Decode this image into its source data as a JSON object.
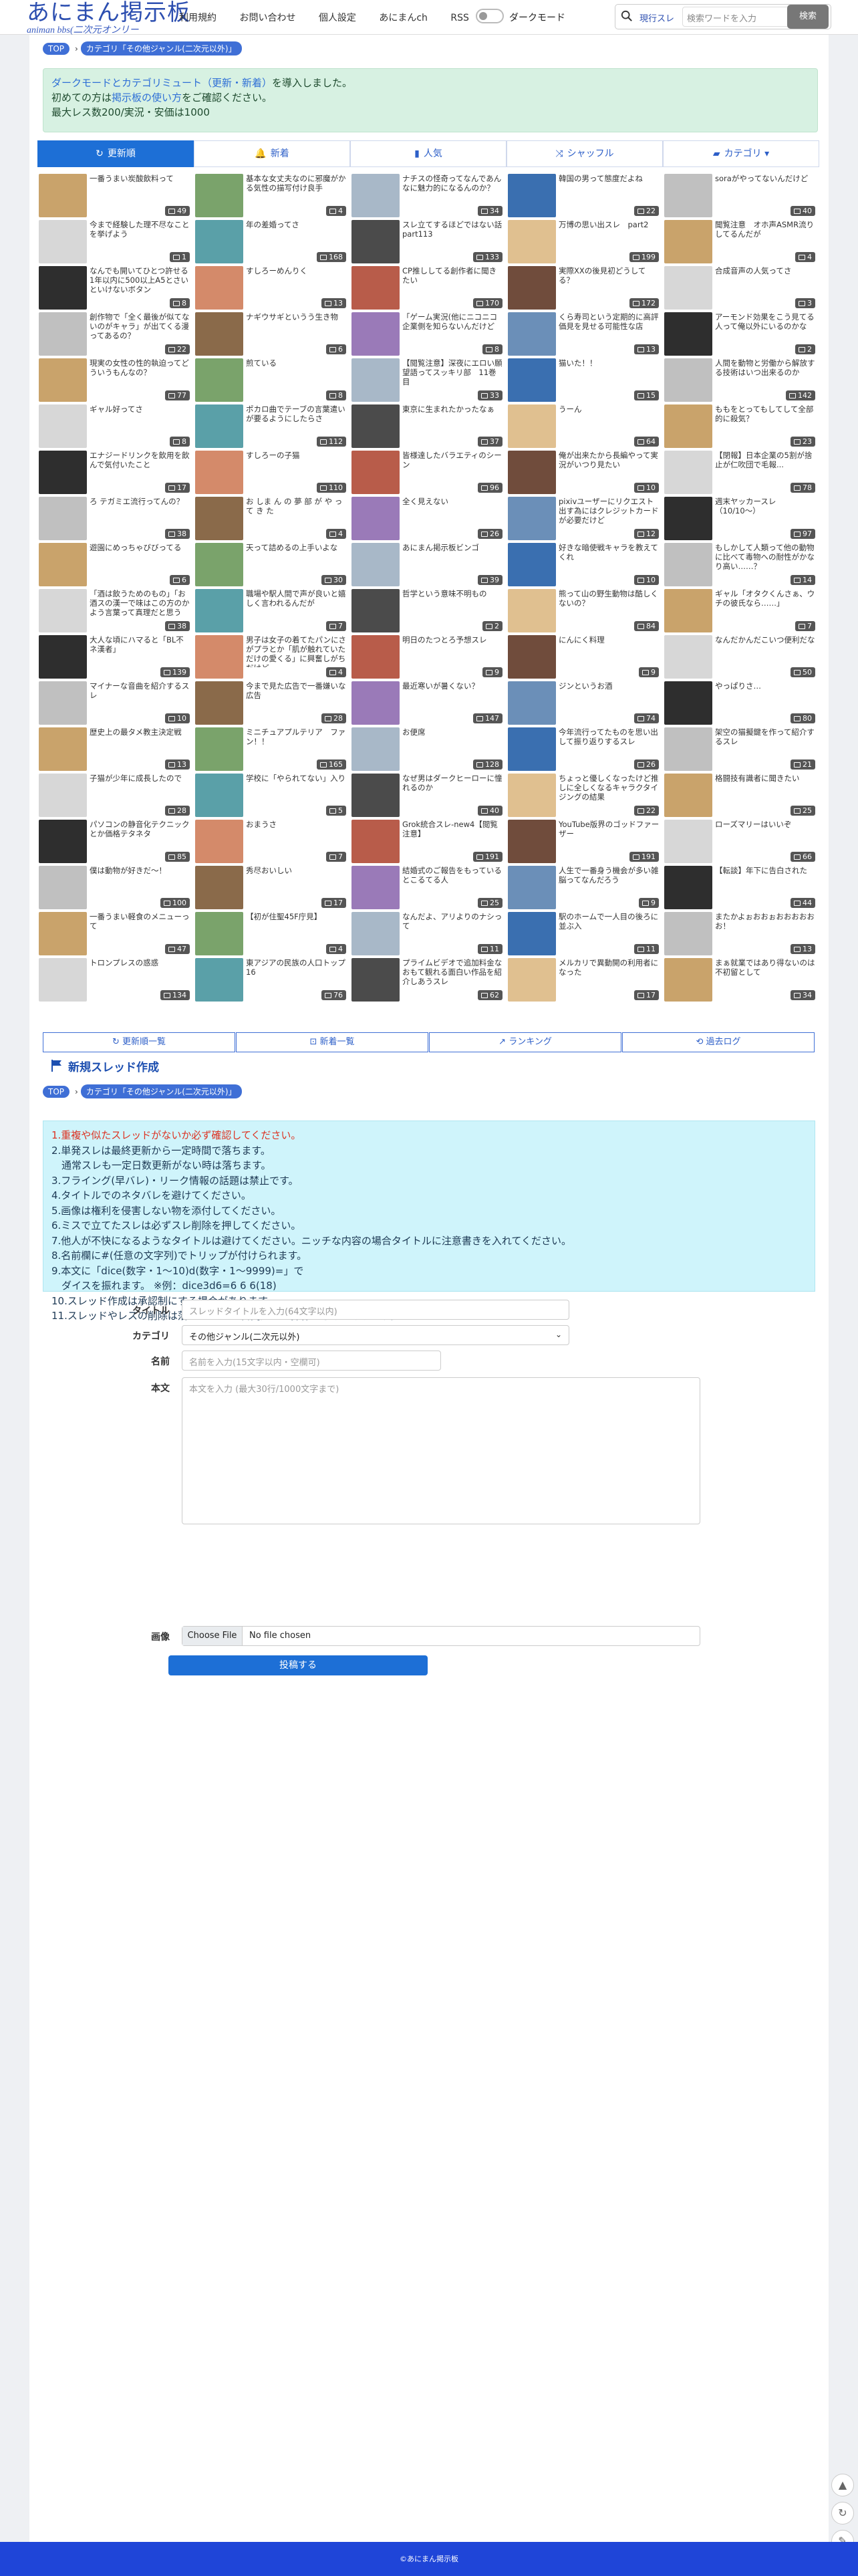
{
  "header": {
    "logo_title": "あにまん掲示板",
    "logo_sub": "animan bbs(二次元オンリー",
    "nav": [
      "利用規約",
      "お問い合わせ",
      "個人設定",
      "あにまんch",
      "RSS"
    ],
    "darkmode_label": "ダークモード",
    "search_scope": "現行スレ",
    "search_placeholder": "検索ワードを入力",
    "search_button": "検索"
  },
  "breadcrumb": {
    "top": "TOP",
    "category": "カテゴリ「その他ジャンル(二次元以外)」"
  },
  "notice": {
    "line1a": "ダークモードとカテゴリミュート（更新・新着）",
    "line1b": "を導入しました。",
    "line2a": "初めての方は",
    "line2b": "掲示板の使い方",
    "line2c": "をご確認ください。",
    "line3": "最大レス数200/実況・安価は1000"
  },
  "tabs": [
    {
      "label": "更新順",
      "icon": "refresh-icon"
    },
    {
      "label": "新着",
      "icon": "bell-icon"
    },
    {
      "label": "人気",
      "icon": "bar-chart-icon"
    },
    {
      "label": "シャッフル",
      "icon": "shuffle-icon"
    },
    {
      "label": "カテゴリ",
      "icon": "folder-icon"
    }
  ],
  "threads": [
    {
      "title": "一番うまい炭酸飲料って",
      "count": "49"
    },
    {
      "title": "基本な女丈夫なのに邪魔がかる気性の描写付け良手",
      "count": "4"
    },
    {
      "title": "ナチスの怪奇ってなんであんなに魅力的になるんのか？",
      "count": "34"
    },
    {
      "title": "韓国の男って態度だよね",
      "count": "22"
    },
    {
      "title": "soraがやってないんだけど",
      "count": "40"
    },
    {
      "title": "今まで経験した理不尽なことを挙げよう",
      "count": "1"
    },
    {
      "title": "年の差婚ってさ",
      "count": "168"
    },
    {
      "title": "スレ立てするほどではない話part113",
      "count": "133"
    },
    {
      "title": "万博の思い出スレ　part2",
      "count": "199"
    },
    {
      "title": "聞覧注意　オホ声ASMR流りしてるんだが",
      "count": "4"
    },
    {
      "title": "なんでも開いてひとつ許せる1年以内に500以上A5とさいといけないボタン",
      "count": "8"
    },
    {
      "title": "すしろーめんりく",
      "count": "13"
    },
    {
      "title": "CP推ししてる創作者に聞きたい",
      "count": "170"
    },
    {
      "title": "実際XXの後見初どうしてる？",
      "count": "172"
    },
    {
      "title": "合成音声の人気ってさ",
      "count": "3"
    },
    {
      "title": "創作物で「全く最後が似てないのがキャラ」が出てくる漫ってあるの？",
      "count": "22"
    },
    {
      "title": "ナギウサギというう生き物",
      "count": "6"
    },
    {
      "title": "「ゲーム実況(他にニコニコ企業側を知らないんだけど",
      "count": "8"
    },
    {
      "title": "くら寿司という定期的に高評価見を見せる可能性な店",
      "count": "13"
    },
    {
      "title": "アーモンド効果をこう見てる人って俺以外にいるのかな",
      "count": "2"
    },
    {
      "title": "現実の女性の性的執迫ってどういうもんなの？",
      "count": "77"
    },
    {
      "title": "煎ている",
      "count": "8"
    },
    {
      "title": "【閲覧注意】深夜にエロい願望語ってスッキリ部　11巻目",
      "count": "33"
    },
    {
      "title": "猫いた！！",
      "count": "15"
    },
    {
      "title": "人間を動物と労働から解放する技術はいつ出来るのか",
      "count": "142"
    },
    {
      "title": "ギャル好ってさ",
      "count": "8"
    },
    {
      "title": "ポカロ曲でテーブの言葉遣いが要るようにしたらさ",
      "count": "112"
    },
    {
      "title": "東京に生まれたかったなぁ",
      "count": "37"
    },
    {
      "title": "うーん",
      "count": "64"
    },
    {
      "title": "ももをとってもしてして全部的に殺気？",
      "count": "23"
    },
    {
      "title": "エナジードリンクを飲用を飲んで気付いたこと",
      "count": "17"
    },
    {
      "title": "すしろーの子猫",
      "count": "110"
    },
    {
      "title": "皆様達したバラエティのシーン",
      "count": "96"
    },
    {
      "title": "俺が出来たから長編やって実況がいつり見たい",
      "count": "10"
    },
    {
      "title": "【閉報】日本企業の5割が捨止が仁吹団で毛報...",
      "count": "78"
    },
    {
      "title": "ろ テガミエ流行ってんの？",
      "count": "38"
    },
    {
      "title": "お しま ん の 夢 部 が や っ て き た",
      "count": "4"
    },
    {
      "title": "全く見えない",
      "count": "26"
    },
    {
      "title": "pixivユーザーにリクエスト出す為にはクレジットカードが必要だけど",
      "count": "12"
    },
    {
      "title": "週末ヤッカースレ（10/10〜）",
      "count": "97"
    },
    {
      "title": "遊園にめっちゃびびってる",
      "count": "6"
    },
    {
      "title": "天って詰めるの上手いよな",
      "count": "30"
    },
    {
      "title": "あにまん掲示板ビンゴ",
      "count": "39"
    },
    {
      "title": "好きな暗使戦キャラを教えてくれ",
      "count": "10"
    },
    {
      "title": "もしかして人類って他の動物に比べて毒物への耐性がかなり高い……？",
      "count": "14"
    },
    {
      "title": "「酒は飲うためのもの」「お酒スの漢一で味はこの方のかよう言葉って真理だと思う",
      "count": "38"
    },
    {
      "title": "職場や駅人間で声が良いと嬉しく言われるんだが",
      "count": "7"
    },
    {
      "title": "哲学という意味不明もの",
      "count": "2"
    },
    {
      "title": "熊って山の野生動物は酷しくないの？",
      "count": "84"
    },
    {
      "title": "ギャル「オタクくんさぁ、ウチの彼氏なら……」",
      "count": "7"
    },
    {
      "title": "大人な頃にハマると「BL不ネ漢者」",
      "count": "139"
    },
    {
      "title": "男子は女子の着てたパンにさがプラとか「肌が触れていただけの愛くる」に興奮しがちだけど",
      "count": "4"
    },
    {
      "title": "明日のたつとろ予想スレ",
      "count": "9"
    },
    {
      "title": "にんにく料理",
      "count": "9"
    },
    {
      "title": "なんだかんだこいつ便利だな",
      "count": "50"
    },
    {
      "title": "マイナーな音曲を紹介するスレ",
      "count": "10"
    },
    {
      "title": "今まで見た広告で一番嫌いな広告",
      "count": "28"
    },
    {
      "title": "最近寒いが暑くない？",
      "count": "147"
    },
    {
      "title": "ジンというお酒",
      "count": "74"
    },
    {
      "title": "やっぱりさ…",
      "count": "80"
    },
    {
      "title": "歴史上の最タメ教主決定戦",
      "count": "13"
    },
    {
      "title": "ミニチュアプルテリア　ファン！！",
      "count": "165"
    },
    {
      "title": "お便席",
      "count": "128"
    },
    {
      "title": "今年流行ってたものを思い出して振り返りするスレ",
      "count": "26"
    },
    {
      "title": "架空の猫擬鍵を作って紹介するスレ",
      "count": "21"
    },
    {
      "title": "子猫が少年に成長したので",
      "count": "28"
    },
    {
      "title": "学校に「やられてない」入り",
      "count": "5"
    },
    {
      "title": "なぜ男はダークヒーローに憧れるのか",
      "count": "40"
    },
    {
      "title": "ちょっと優しくなったけど推しに全しくなるキャラクタイジングの結果",
      "count": "22"
    },
    {
      "title": "格闘技有識者に聞きたい",
      "count": "25"
    },
    {
      "title": "パソコンの静音化テクニックとか価格テタネタ",
      "count": "85"
    },
    {
      "title": "おまうさ",
      "count": "7"
    },
    {
      "title": "Grok統合スレ-new4【閲覧注意】",
      "count": "191"
    },
    {
      "title": "YouTube版界のゴッドファーザー",
      "count": "191"
    },
    {
      "title": "ローズマリーはいいぞ",
      "count": "66"
    },
    {
      "title": "僕は動物が好きだ～！",
      "count": "100"
    },
    {
      "title": "秀尽おいしい",
      "count": "17"
    },
    {
      "title": "結婚式のご報告をもっているとこるてる人",
      "count": "25"
    },
    {
      "title": "人生で一番身う機会が多い雑脳ってなんだろう",
      "count": "9"
    },
    {
      "title": "【転談】年下に告白された",
      "count": "44"
    },
    {
      "title": "一番うまい軽食のメニューって",
      "count": "47"
    },
    {
      "title": "【初が住聖45F庁見】",
      "count": "4"
    },
    {
      "title": "なんだよ、アリよりのナシって",
      "count": "11"
    },
    {
      "title": "駅のホームで一人目の後ろに並ぶ入",
      "count": "11"
    },
    {
      "title": "またかよぉおおぉおおおおおお！",
      "count": "13"
    },
    {
      "title": "トロンプレスの惑惑",
      "count": "134"
    },
    {
      "title": "東アジアの民族の人口トップ16",
      "count": "76"
    },
    {
      "title": "プライムビデオで追加料金なおもて観れる面白い作品を紹介しあうスレ",
      "count": "62"
    },
    {
      "title": "メルカリで異動開の利用者になった",
      "count": "17"
    },
    {
      "title": "まぁ就業ではあり得ないのは不初留として",
      "count": "34"
    }
  ],
  "bottom_links": [
    {
      "label": "更新順一覧",
      "icon": "refresh-icon"
    },
    {
      "label": "新着一覧",
      "icon": "new-icon"
    },
    {
      "label": "ランキング",
      "icon": "chart-icon"
    },
    {
      "label": "過去ログ",
      "icon": "history-icon"
    }
  ],
  "new_thread": {
    "heading": "新規スレッド作成",
    "rules": [
      "1.重複や似たスレッドがないか必ず確認してください。",
      "2.単発スレは最終更新から一定時間で落ちます。",
      "　通常スレも一定日数更新がない時は落ちます。",
      "3.フライング(早バレ)・リーク情報の話題は禁止です。",
      "4.タイトルでのネタバレを避けてください。",
      "5.画像は権利を侵害しない物を添付してください。",
      "6.ミスで立てたスレは必ずスレ削除を押してください。",
      "7.他人が不快になるようなタイトルは避けてください。ニッチな内容の場合タイトルに注意書きを入れてください。",
      "8.名前欄に#(任意の文字列)でトリップが付けられます。",
      "9.本文に「dice(数字・1〜10)d(数字・1〜9999)=」で",
      "　ダイスを振れます。 ※例：dice3d6=6 6 6(18)",
      "10.スレッド作成は承認制にする場合があります。",
      "11.スレッドやレスの削除は落ちてから10日間経つと操作できなくなります。"
    ],
    "title_label": "タイトル",
    "title_placeholder": "スレッドタイトルを入力(64文字以内)",
    "category_label": "カテゴリ",
    "category_value": "その他ジャンル(二次元以外)",
    "name_label": "名前",
    "name_placeholder": "名前を入力(15文字以内・空欄可)",
    "body_label": "本文",
    "body_placeholder": "本文を入力 (最大30行/1000文字まで)",
    "image_label": "画像",
    "file_button": "Choose File",
    "file_status": "No file chosen",
    "submit_label": "投稿する"
  },
  "footer": "©あにまん掲示板"
}
